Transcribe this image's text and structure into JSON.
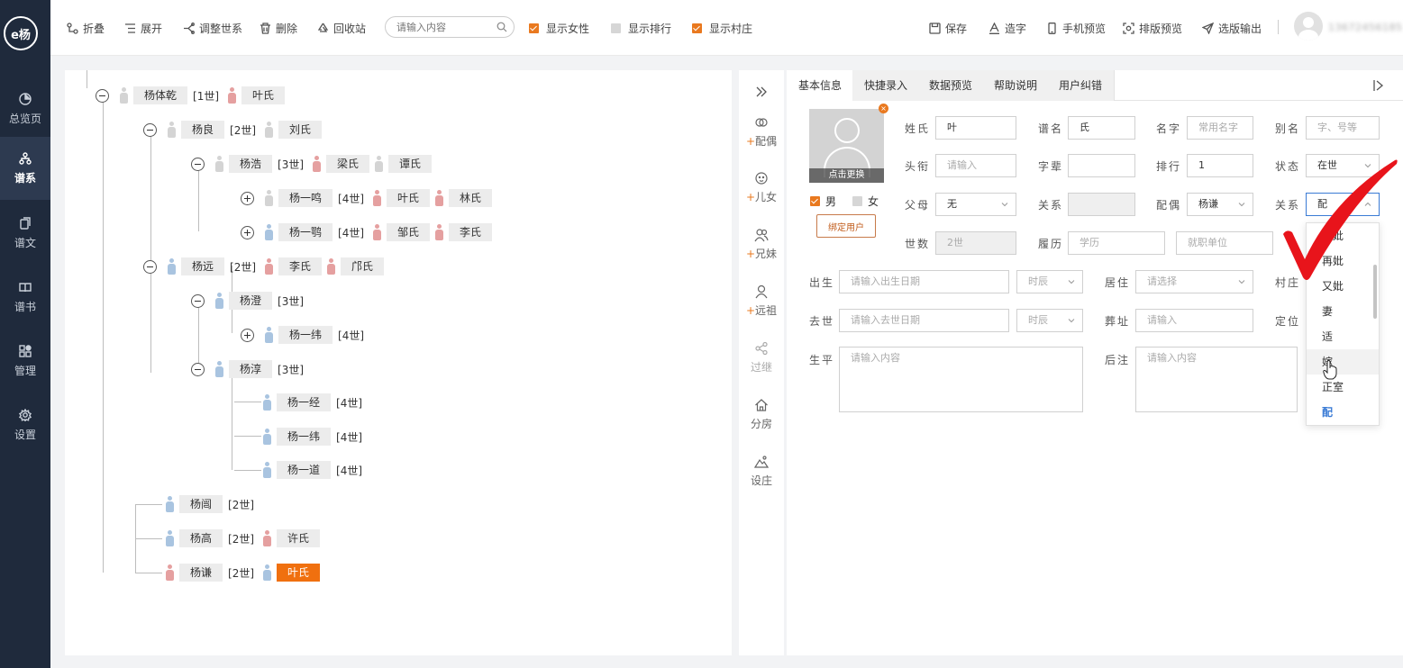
{
  "app": {
    "logo_text": "e杨"
  },
  "sidebar": {
    "items": [
      {
        "label": "总览页",
        "icon": "pie-chart-icon"
      },
      {
        "label": "谱系",
        "icon": "tree-icon"
      },
      {
        "label": "谱文",
        "icon": "copy-icon"
      },
      {
        "label": "谱书",
        "icon": "book-icon"
      },
      {
        "label": "管理",
        "icon": "grid-icon"
      },
      {
        "label": "设置",
        "icon": "gear-icon"
      }
    ]
  },
  "toolbar": {
    "fold": "折叠",
    "expand": "展开",
    "adjust": "调整世系",
    "delete": "删除",
    "recycle": "回收站",
    "search_placeholder": "请输入内容",
    "show_female": "显示女性",
    "show_rank": "显示排行",
    "show_village": "显示村庄",
    "show_female_checked": true,
    "show_rank_checked": false,
    "show_village_checked": true,
    "save": "保存",
    "make_char": "造字",
    "mobile_preview": "手机预览",
    "layout_preview": "排版预览",
    "export": "选版输出",
    "phone": "13672456185"
  },
  "tree": {
    "nodes": [
      {
        "name": "杨体乾",
        "gen": "[1世]",
        "spouses": [
          "叶氏"
        ]
      },
      {
        "name": "杨良",
        "gen": "[2世]",
        "spouses": [
          "刘氏"
        ]
      },
      {
        "name": "杨浩",
        "gen": "[3世]",
        "spouses": [
          "梁氏",
          "谭氏"
        ]
      },
      {
        "name": "杨一鸣",
        "gen": "[4世]",
        "spouses": [
          "叶氏",
          "林氏"
        ]
      },
      {
        "name": "杨一鹗",
        "gen": "[4世]",
        "spouses": [
          "邹氏",
          "李氏"
        ]
      },
      {
        "name": "杨远",
        "gen": "[2世]",
        "spouses": [
          "李氏",
          "邝氏"
        ]
      },
      {
        "name": "杨澄",
        "gen": "[3世]",
        "spouses": []
      },
      {
        "name": "杨一纬",
        "gen": "[4世]",
        "spouses": []
      },
      {
        "name": "杨淳",
        "gen": "[3世]",
        "spouses": []
      },
      {
        "name": "杨一经",
        "gen": "[4世]",
        "spouses": []
      },
      {
        "name": "杨一纬",
        "gen": "[4世]",
        "spouses": []
      },
      {
        "name": "杨一道",
        "gen": "[4世]",
        "spouses": []
      },
      {
        "name": "杨闿",
        "gen": "[2世]",
        "spouses": []
      },
      {
        "name": "杨高",
        "gen": "[2世]",
        "spouses": [
          "许氏"
        ]
      },
      {
        "name": "杨谦",
        "gen": "[2世]",
        "spouses": [
          "叶氏"
        ]
      }
    ]
  },
  "actions": [
    {
      "label": "配偶",
      "plus": "+",
      "icon": "spouse-icon"
    },
    {
      "label": "儿女",
      "plus": "+",
      "icon": "child-icon"
    },
    {
      "label": "兄妹",
      "plus": "+",
      "icon": "siblings-icon"
    },
    {
      "label": "远祖",
      "plus": "+",
      "icon": "ancestor-icon"
    },
    {
      "label": "过继",
      "plus": "",
      "icon": "share-icon"
    },
    {
      "label": "分房",
      "plus": "",
      "icon": "house-icon"
    },
    {
      "label": "设庄",
      "plus": "",
      "icon": "landscape-icon"
    }
  ],
  "detail": {
    "tabs": [
      "基本信息",
      "快捷录入",
      "数据预览",
      "帮助说明",
      "用户纠错"
    ],
    "photo_btn": "点击更换",
    "photo_remove": "×",
    "male": "男",
    "female": "女",
    "bind_user": "绑定用户",
    "fields": {
      "surname_label": "姓氏",
      "surname": "叶",
      "pu_name_label": "谱名",
      "pu_name": "氏",
      "name_label": "名字",
      "name_ph": "常用名字",
      "alias_label": "别名",
      "alias_ph": "字、号等",
      "title_label": "头衔",
      "title_ph": "请输入",
      "zibei_label": "字辈",
      "zibei": "",
      "rank_label": "排行",
      "rank": "1",
      "status_label": "状态",
      "status": "在世",
      "parent_label": "父母",
      "parent": "无",
      "relation_label": "关系",
      "relation": "",
      "spouse_label": "配偶",
      "spouse": "杨谦",
      "relation2_label": "关系",
      "relation2": "配",
      "gen_label": "世数",
      "gen": "2世",
      "resume_label": "履历",
      "edu_ph": "学历",
      "job_ph": "就职单位",
      "birth_label": "出生",
      "birth_ph": "请输入出生日期",
      "birth_time": "时辰",
      "reside_label": "居住",
      "reside_ph": "请选择",
      "village_label": "村庄",
      "death_label": "去世",
      "death_ph": "请输入去世日期",
      "death_time": "时辰",
      "burial_label": "葬址",
      "burial_ph": "请输入",
      "locate_label": "定位",
      "life_label": "生平",
      "life_ph": "请输入内容",
      "note_label": "后注",
      "note_ph": "请输入内容"
    }
  },
  "dropdown": {
    "options": [
      "继妣",
      "再妣",
      "又妣",
      "妻",
      "适",
      "嫁",
      "正室",
      "配"
    ],
    "hovered": "嫁",
    "selected": "配"
  },
  "colors": {
    "accent": "#e9791f",
    "selected_node": "#f0700f",
    "sidebar": "#1f2a3c",
    "check": "#e8141b"
  }
}
